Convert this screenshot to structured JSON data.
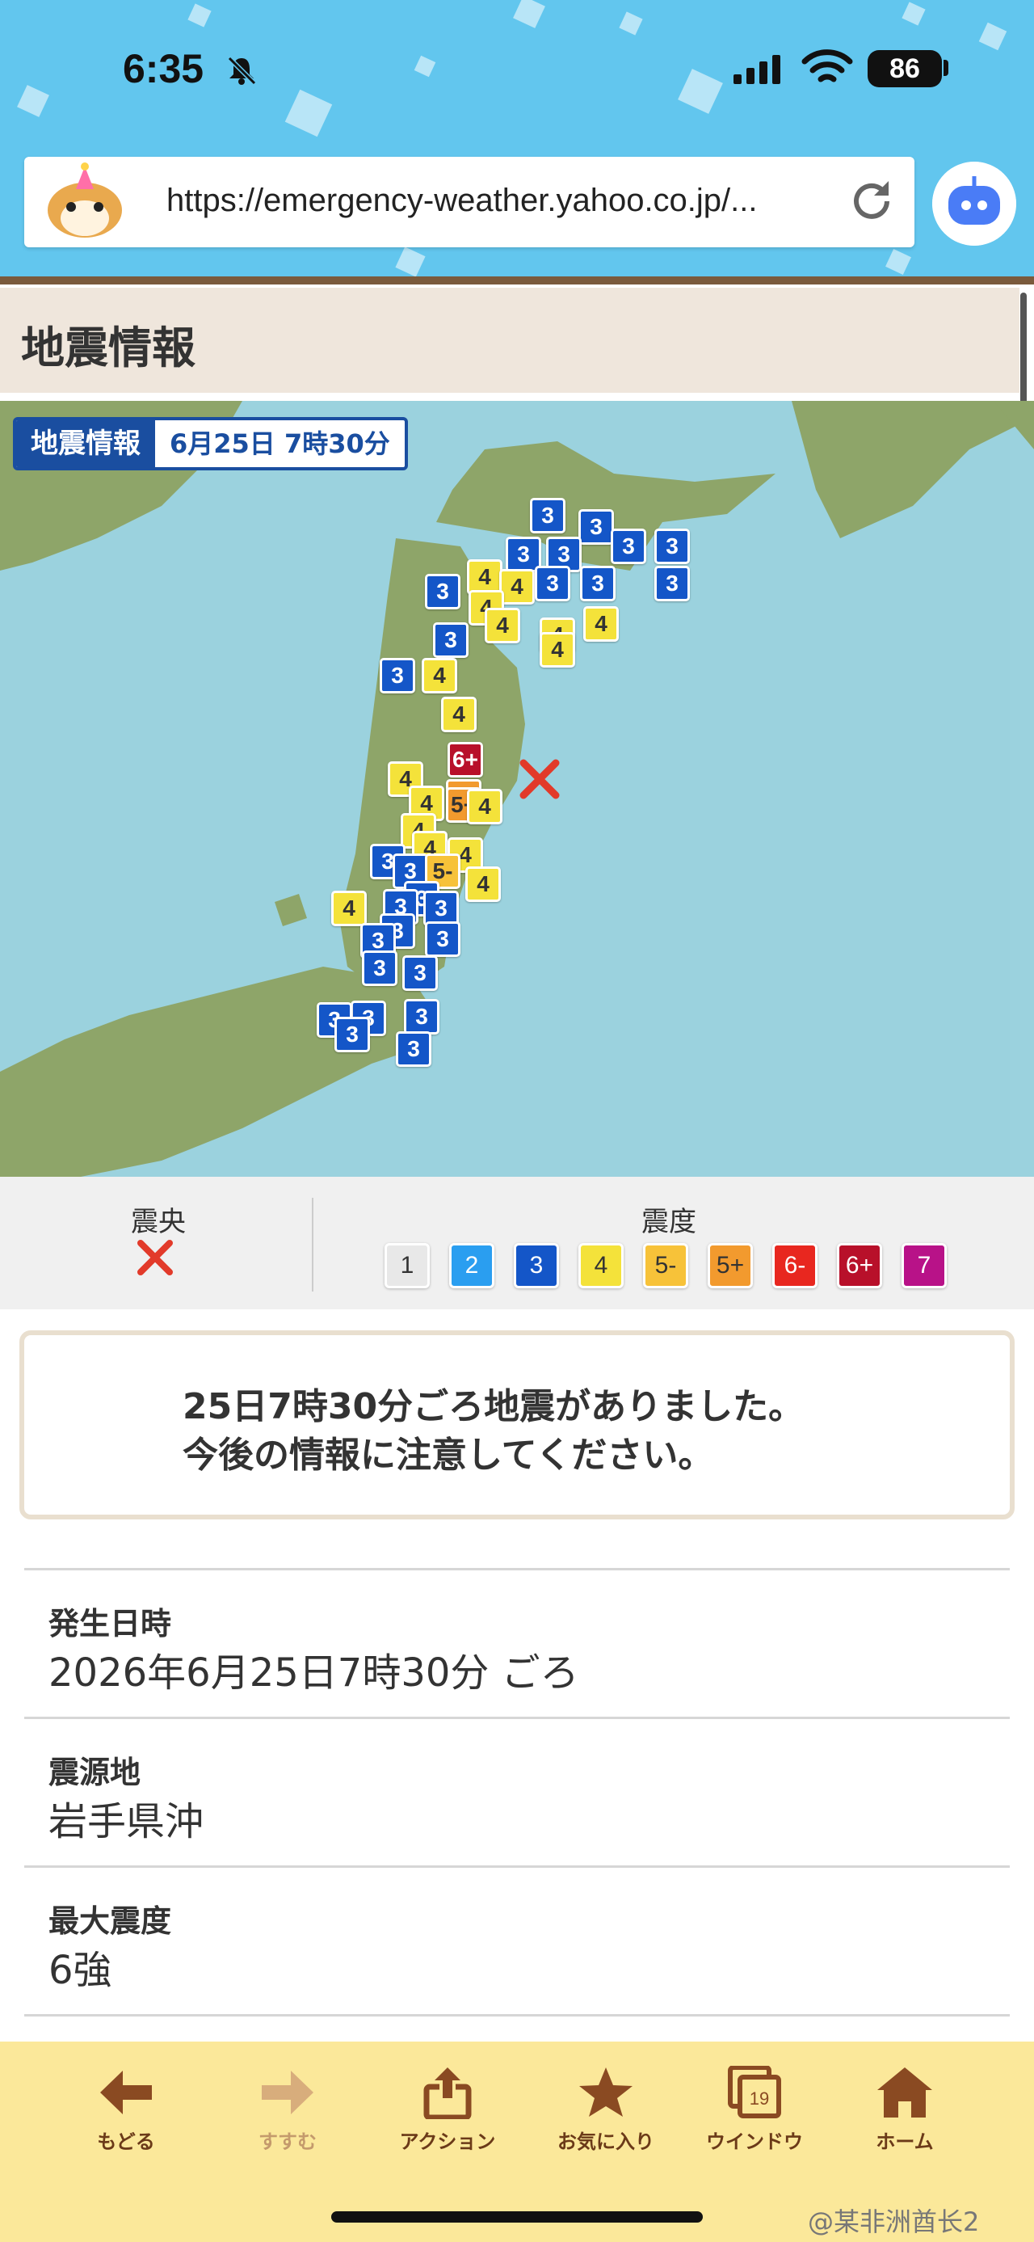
{
  "status_bar": {
    "time": "6:35",
    "battery": "86"
  },
  "browser": {
    "url": "https://emergency-weather.yahoo.co.jp/..."
  },
  "page": {
    "title": "地震情報"
  },
  "map": {
    "chip_label": "地震情報",
    "chip_date": "6月25日 7時30分",
    "markers": [
      {
        "label": "3",
        "color": "#1456c8"
      },
      {
        "label": "3",
        "color": "#1456c8"
      },
      {
        "label": "3",
        "color": "#1456c8"
      },
      {
        "label": "3",
        "color": "#1456c8"
      },
      {
        "label": "3",
        "color": "#1456c8"
      },
      {
        "label": "3",
        "color": "#1456c8"
      },
      {
        "label": "3",
        "color": "#1456c8"
      },
      {
        "label": "3",
        "color": "#1456c8"
      },
      {
        "label": "4",
        "color": "#f4e23a"
      },
      {
        "label": "4",
        "color": "#f4e23a"
      },
      {
        "label": "3",
        "color": "#1456c8"
      },
      {
        "label": "3",
        "color": "#1456c8"
      },
      {
        "label": "4",
        "color": "#f4e23a"
      },
      {
        "label": "4",
        "color": "#f4e23a"
      },
      {
        "label": "4",
        "color": "#f4e23a"
      },
      {
        "label": "4",
        "color": "#f4e23a"
      },
      {
        "label": "3",
        "color": "#1456c8"
      },
      {
        "label": "4",
        "color": "#f4e23a"
      },
      {
        "label": "3",
        "color": "#1456c8"
      },
      {
        "label": "4",
        "color": "#f4e23a"
      },
      {
        "label": "4",
        "color": "#f4e23a"
      },
      {
        "label": "6+",
        "color": "#b8102a"
      },
      {
        "label": "4",
        "color": "#f4e23a"
      },
      {
        "label": "4",
        "color": "#f4e23a"
      },
      {
        "label": "5+",
        "color": "#f29a2e"
      },
      {
        "label": "5+",
        "color": "#f29a2e"
      },
      {
        "label": "4",
        "color": "#f4e23a"
      },
      {
        "label": "4",
        "color": "#f4e23a"
      },
      {
        "label": "4",
        "color": "#f4e23a"
      },
      {
        "label": "4",
        "color": "#f4e23a"
      },
      {
        "label": "3",
        "color": "#1456c8"
      },
      {
        "label": "3",
        "color": "#1456c8"
      },
      {
        "label": "5-",
        "color": "#f7c239"
      },
      {
        "label": "4",
        "color": "#f4e23a"
      },
      {
        "label": "3",
        "color": "#1456c8"
      },
      {
        "label": "3",
        "color": "#1456c8"
      },
      {
        "label": "4",
        "color": "#f4e23a"
      },
      {
        "label": "3",
        "color": "#1456c8"
      },
      {
        "label": "3",
        "color": "#1456c8"
      },
      {
        "label": "3",
        "color": "#1456c8"
      },
      {
        "label": "3",
        "color": "#1456c8"
      },
      {
        "label": "3",
        "color": "#1456c8"
      },
      {
        "label": "3",
        "color": "#1456c8"
      },
      {
        "label": "3",
        "color": "#1456c8"
      },
      {
        "label": "3",
        "color": "#1456c8"
      },
      {
        "label": "3",
        "color": "#1456c8"
      },
      {
        "label": "3",
        "color": "#1456c8"
      },
      {
        "label": "3",
        "color": "#1456c8"
      }
    ]
  },
  "legend": {
    "epicenter_label": "震央",
    "intensity_label": "震度",
    "scale": [
      {
        "label": "1",
        "color": "#e8e8e8",
        "text": "#333333"
      },
      {
        "label": "2",
        "color": "#2a9ef0",
        "text": "#ffffff"
      },
      {
        "label": "3",
        "color": "#1456c8",
        "text": "#ffffff"
      },
      {
        "label": "4",
        "color": "#f4e23a",
        "text": "#333333"
      },
      {
        "label": "5-",
        "color": "#f7c239",
        "text": "#333333"
      },
      {
        "label": "5+",
        "color": "#f29a2e",
        "text": "#333333"
      },
      {
        "label": "6-",
        "color": "#e8271f",
        "text": "#ffffff"
      },
      {
        "label": "6+",
        "color": "#b8102a",
        "text": "#ffffff"
      },
      {
        "label": "7",
        "color": "#b81288",
        "text": "#ffffff"
      }
    ]
  },
  "notice": {
    "line1": "25日7時30分ごろ地震がありました。",
    "line2": "今後の情報に注意してください。"
  },
  "details": {
    "time_label": "発生日時",
    "time_value": "2026年6月25日7時30分 ごろ",
    "epicenter_label": "震源地",
    "epicenter_value": "岩手県沖",
    "max_label": "最大震度",
    "max_value": "6強"
  },
  "toolbar": {
    "back": "もどる",
    "forward": "すすむ",
    "action": "アクション",
    "favorites": "お気に入り",
    "window": "ウインドウ",
    "window_count": "19",
    "home": "ホーム"
  },
  "watermark": "@某非洲酋长2"
}
